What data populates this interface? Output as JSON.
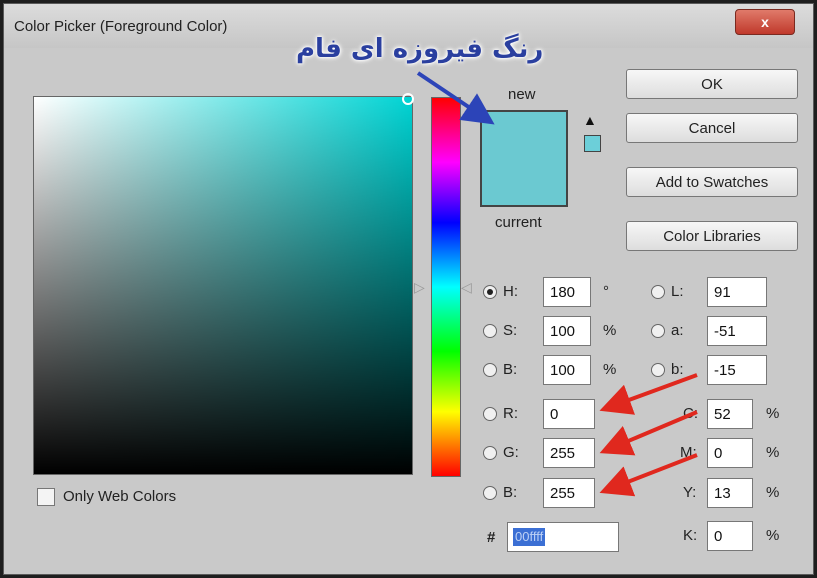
{
  "window": {
    "title": "Color Picker (Foreground Color)",
    "close_label": "x"
  },
  "annotation": {
    "text": "رنگ فیروزه ای فام"
  },
  "swatches": {
    "new_label": "new",
    "current_label": "current",
    "new_color": "#6bc9d1"
  },
  "buttons": {
    "ok": "OK",
    "cancel": "Cancel",
    "add_to_swatches": "Add to Swatches",
    "color_libraries": "Color Libraries"
  },
  "hsb": {
    "h": {
      "label": "H:",
      "value": "180",
      "unit": "°",
      "selected": true
    },
    "s": {
      "label": "S:",
      "value": "100",
      "unit": "%"
    },
    "b": {
      "label": "B:",
      "value": "100",
      "unit": "%"
    }
  },
  "rgb": {
    "r": {
      "label": "R:",
      "value": "0"
    },
    "g": {
      "label": "G:",
      "value": "255"
    },
    "b": {
      "label": "B:",
      "value": "255"
    }
  },
  "lab": {
    "l": {
      "label": "L:",
      "value": "91"
    },
    "a": {
      "label": "a:",
      "value": "-51"
    },
    "b": {
      "label": "b:",
      "value": "-15"
    }
  },
  "cmyk": {
    "c": {
      "label": "C:",
      "value": "52",
      "unit": "%"
    },
    "m": {
      "label": "M:",
      "value": "0",
      "unit": "%"
    },
    "y": {
      "label": "Y:",
      "value": "13",
      "unit": "%"
    },
    "k": {
      "label": "K:",
      "value": "0",
      "unit": "%"
    }
  },
  "hex": {
    "label": "#",
    "value": "00ffff"
  },
  "options": {
    "only_web_colors": "Only Web Colors"
  },
  "colors": {
    "arrow_blue": "#2c44b8",
    "arrow_red": "#e0281e",
    "selection": "#3b6fd4"
  }
}
